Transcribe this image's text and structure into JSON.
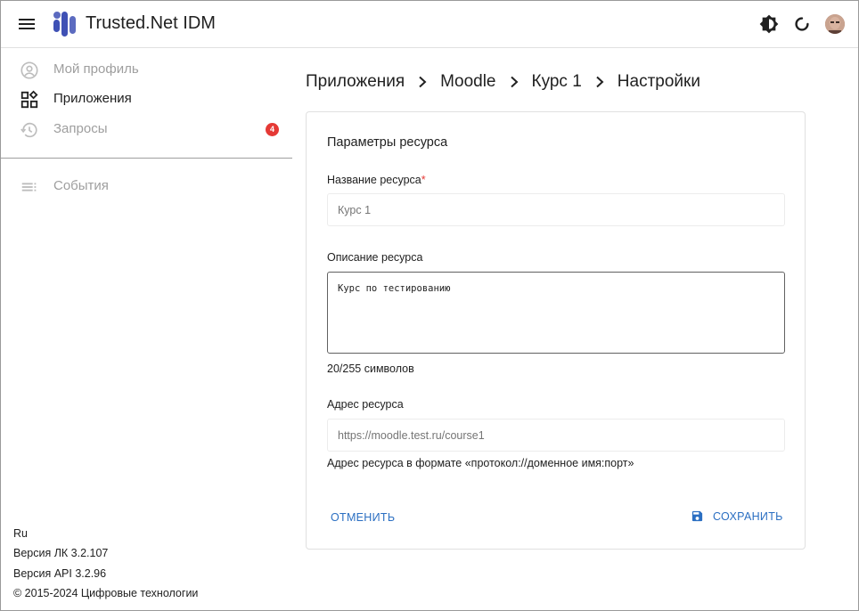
{
  "header": {
    "app_title": "Trusted.Net IDM",
    "icons": [
      "menu-icon",
      "logo-icon",
      "theme-toggle-icon",
      "refresh-icon",
      "avatar"
    ]
  },
  "sidebar": {
    "items": [
      {
        "label": "Мой профиль",
        "icon": "account-circle-icon"
      },
      {
        "label": "Приложения",
        "icon": "apps-icon"
      },
      {
        "label": "Запросы",
        "icon": "history-icon",
        "badge": "4"
      },
      {
        "label": "События",
        "icon": "list-icon"
      }
    ],
    "footer": {
      "language": "Ru",
      "lk_version": "Версия ЛК 3.2.107",
      "api_version": "Версия API 3.2.96",
      "copyright": "© 2015-2024 Цифровые технологии"
    }
  },
  "breadcrumb": [
    "Приложения",
    "Moodle",
    "Курс 1",
    "Настройки"
  ],
  "form": {
    "title": "Параметры ресурса",
    "name_label": "Название ресурса",
    "name_required_mark": "*",
    "name_placeholder": "Курс 1",
    "description_label": "Описание ресурса",
    "description_value": "Курс по тестированию",
    "description_counter": "20/255 символов",
    "address_label": "Адрес ресурса",
    "address_placeholder": "https://moodle.test.ru/course1",
    "address_hint": "Адрес ресурса в формате «протокол://доменное имя:порт»",
    "cancel_label": "ОТМЕНИТЬ",
    "save_label": "СОХРАНИТЬ"
  },
  "colors": {
    "accent": "#2b6fc2",
    "badge": "#e53935",
    "logo": "#3f51b5"
  }
}
